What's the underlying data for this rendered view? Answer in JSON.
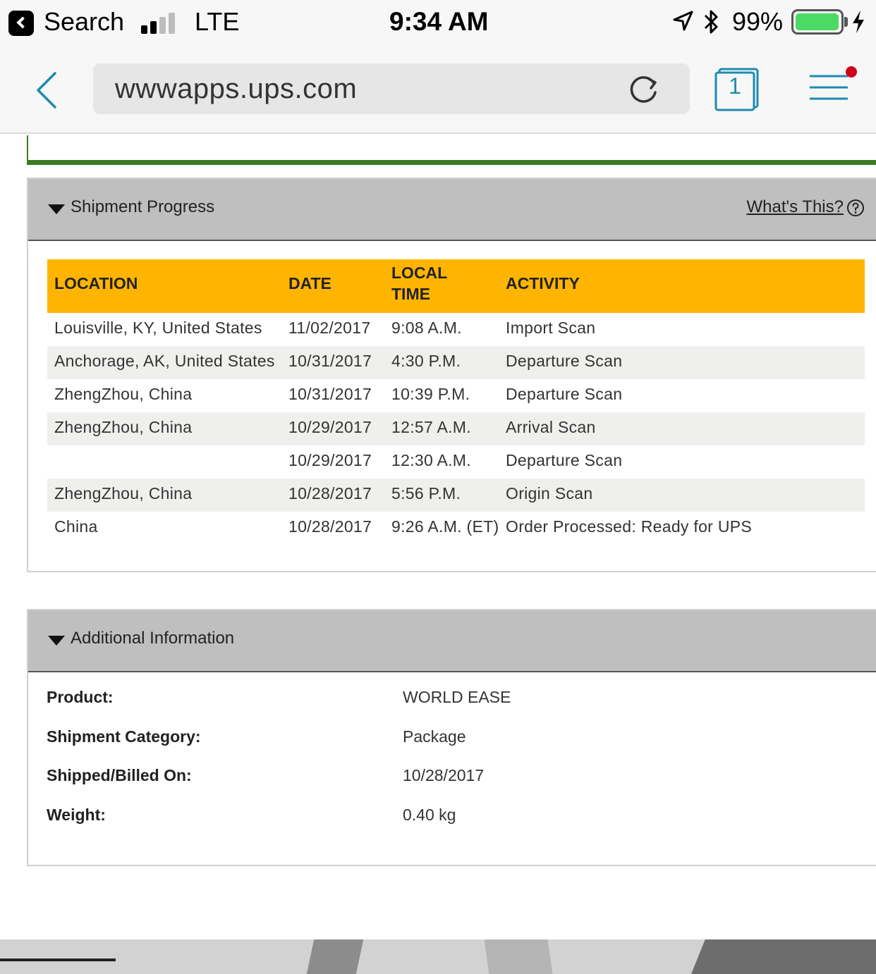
{
  "status_bar": {
    "back_app": "Search",
    "network": "LTE",
    "time": "9:34 AM",
    "battery_percent": "99%",
    "signal_bars_on": 2,
    "signal_bars_total": 4,
    "battery_level": 0.99,
    "battery_color": "#4cd964"
  },
  "browser": {
    "url": "wwwapps.ups.com",
    "tab_count": "1",
    "accent_color": "#1d8bb0",
    "notification_dot_color": "#d0021b"
  },
  "shipment_progress": {
    "title": "Shipment Progress",
    "help_link": "What's This?",
    "header_color": "#ffb500",
    "columns": {
      "location": "LOCATION",
      "date": "DATE",
      "local_time": "LOCAL TIME",
      "activity": "ACTIVITY"
    },
    "rows": [
      {
        "location": "Louisville,  KY,  United States",
        "date": "11/02/2017",
        "time": "9:08 A.M.",
        "activity": "Import Scan"
      },
      {
        "location": "Anchorage,  AK,  United States",
        "date": "10/31/2017",
        "time": "4:30 P.M.",
        "activity": "Departure Scan"
      },
      {
        "location": "ZhengZhou,  China",
        "date": "10/31/2017",
        "time": "10:39 P.M.",
        "activity": "Departure Scan"
      },
      {
        "location": "ZhengZhou,  China",
        "date": "10/29/2017",
        "time": "12:57 A.M.",
        "activity": "Arrival Scan"
      },
      {
        "location": "",
        "date": "10/29/2017",
        "time": "12:30 A.M.",
        "activity": "Departure Scan"
      },
      {
        "location": "ZhengZhou,  China",
        "date": "10/28/2017",
        "time": "5:56 P.M.",
        "activity": "Origin Scan"
      },
      {
        "location": "China",
        "date": "10/28/2017",
        "time": "9:26 A.M. (ET)",
        "activity": "Order Processed: Ready for UPS"
      }
    ]
  },
  "additional_information": {
    "title": "Additional Information",
    "fields": [
      {
        "label": "Product:",
        "value": "WORLD EASE"
      },
      {
        "label": "Shipment Category:",
        "value": "Package"
      },
      {
        "label": "Shipped/Billed On:",
        "value": "10/28/2017"
      },
      {
        "label": "Weight:",
        "value": "0.40 kg"
      }
    ]
  }
}
